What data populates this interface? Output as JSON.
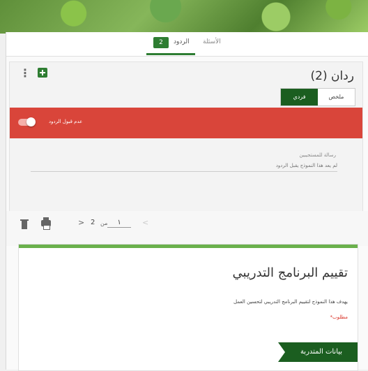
{
  "tabs": {
    "questions_label": "الأسئلة",
    "responses_label": "الردود",
    "responses_count": "2"
  },
  "responses": {
    "title": "ردان (2)",
    "view_summary": "ملخص",
    "view_individual": "فردي",
    "accepting_label": "عدم قبول الردود",
    "message_label": "رسالة للمستجيبين",
    "message_placeholder": "لم يعد هذا النموذج يقبل الردود"
  },
  "navigator": {
    "current": "١",
    "of_label": "من",
    "total": "2"
  },
  "form": {
    "title": "تقييم البرنامج التدريبي",
    "description": "يهدف هذا النموذج لتقييم البرنامج التدريبي لتحسين العمل",
    "required_note": "*مطلوب",
    "section_title": "بيانات المتدربة"
  },
  "colors": {
    "accent": "#2e7d32",
    "banner_red": "#d9453a",
    "form_top": "#6ab04c"
  },
  "icons": [
    "more-vert-icon",
    "sheets-icon",
    "trash-icon",
    "print-icon",
    "chevron-right-icon",
    "chevron-left-icon"
  ]
}
